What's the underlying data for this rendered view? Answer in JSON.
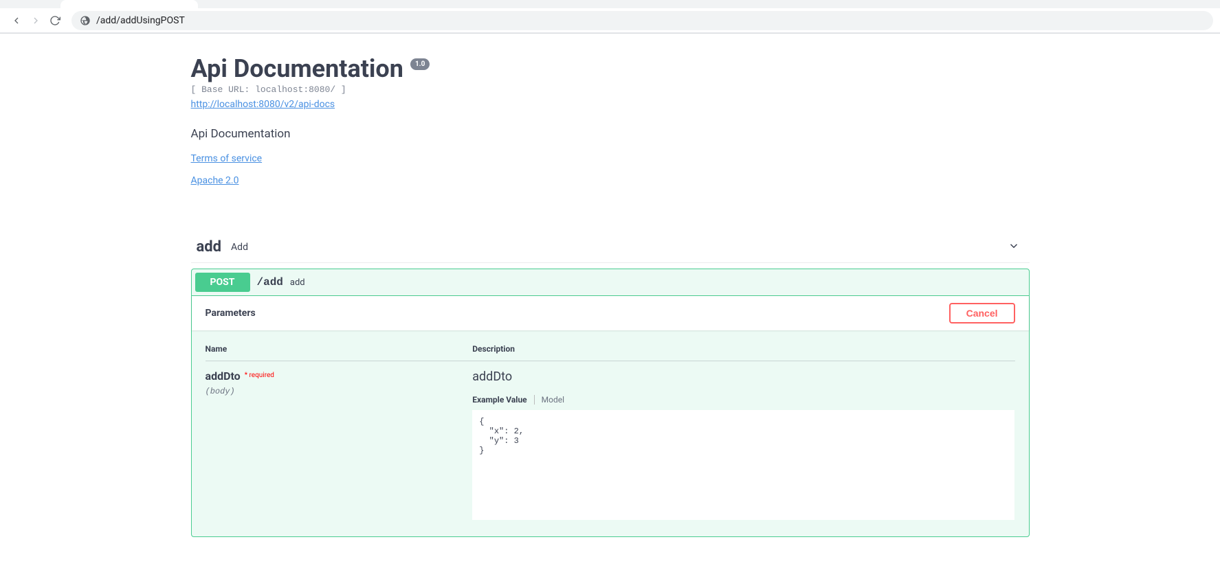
{
  "browser": {
    "url": "/add/addUsingPOST"
  },
  "info": {
    "title": "Api Documentation",
    "version": "1.0",
    "base_url_label": "[ Base URL: localhost:8080/ ]",
    "docs_url": "http://localhost:8080/v2/api-docs",
    "description": "Api Documentation",
    "terms_label": "Terms of service",
    "license_label": "Apache 2.0"
  },
  "tag": {
    "name": "add",
    "description": "Add"
  },
  "operation": {
    "method": "POST",
    "path": "/add",
    "summary": "add",
    "parameters_label": "Parameters",
    "cancel_label": "Cancel",
    "col_name": "Name",
    "col_desc": "Description",
    "param": {
      "name": "addDto",
      "required_label": "required",
      "in": "(body)",
      "description": "addDto",
      "tab_example": "Example Value",
      "tab_model": "Model",
      "example_json": "{\n  \"x\": 2,\n  \"y\": 3\n}"
    }
  }
}
